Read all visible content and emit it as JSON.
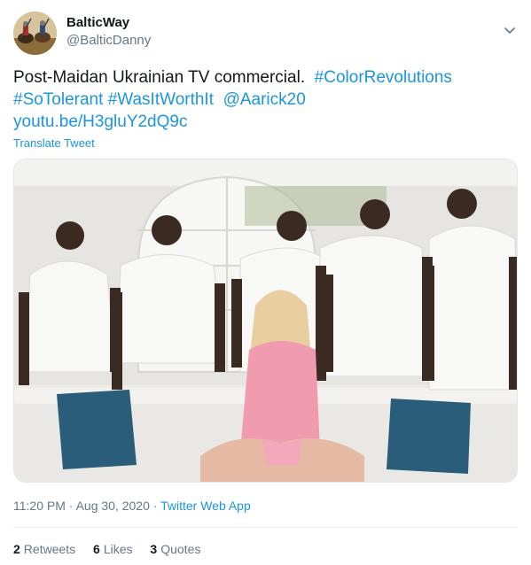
{
  "author": {
    "display_name": "BalticWay",
    "handle": "@BalticDanny",
    "avatar_icon": "knights-on-horseback-avatar"
  },
  "tweet": {
    "text_plain": "Post-Maidan Ukrainian TV commercial.",
    "hashtag_1": "#ColorRevolutions",
    "hashtag_2": "#SoTolerant",
    "hashtag_3": "#WasItWorthIt",
    "mention": "@Aarick20",
    "link": "youtu.be/H3gluY2dQ9c",
    "translate_label": "Translate Tweet"
  },
  "meta": {
    "time": "11:20 PM",
    "separator": "·",
    "date": "Aug 30, 2020",
    "source": "Twitter Web App"
  },
  "stats": {
    "retweets_count": "2",
    "retweets_label": "Retweets",
    "likes_count": "6",
    "likes_label": "Likes",
    "quotes_count": "3",
    "quotes_label": "Quotes"
  },
  "colors": {
    "link": "#1b95e0",
    "secondary_text": "#657786",
    "primary_text": "#14171a",
    "divider": "#e6ecf0"
  }
}
